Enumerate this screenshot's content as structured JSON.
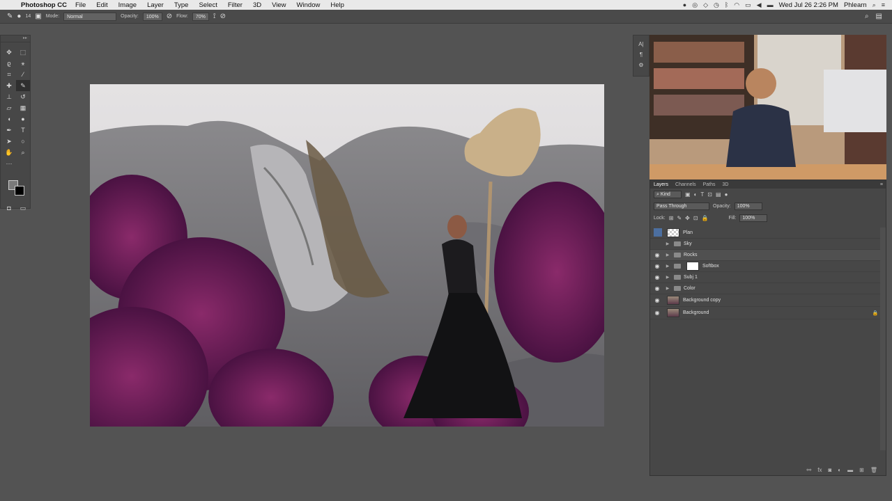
{
  "menubar": {
    "app_name": "Photoshop CC",
    "items": [
      "File",
      "Edit",
      "Image",
      "Layer",
      "Type",
      "Select",
      "Filter",
      "3D",
      "View",
      "Window",
      "Help"
    ],
    "datetime": "Wed Jul 26  2:26 PM",
    "user": "Phlearn"
  },
  "options": {
    "brush_size": "14",
    "mode_label": "Mode:",
    "mode_value": "Normal",
    "opacity_label": "Opacity:",
    "opacity_value": "100%",
    "flow_label": "Flow:",
    "flow_value": "70%"
  },
  "layers_panel": {
    "tabs": [
      "Layers",
      "Channels",
      "Paths",
      "3D"
    ],
    "filter_kind": "Kind",
    "blend_mode": "Pass Through",
    "opacity_label": "Opacity:",
    "opacity_value": "100%",
    "lock_label": "Lock:",
    "fill_label": "Fill:",
    "fill_value": "100%",
    "layers": [
      {
        "name": "Plan",
        "visible": false,
        "type": "layer",
        "thumb": "transparent"
      },
      {
        "name": "Sky",
        "visible": false,
        "type": "group"
      },
      {
        "name": "Rocks",
        "visible": true,
        "type": "group"
      },
      {
        "name": "Softbox",
        "visible": true,
        "type": "group-mask"
      },
      {
        "name": "Subj 1",
        "visible": true,
        "type": "group"
      },
      {
        "name": "Color",
        "visible": true,
        "type": "group"
      },
      {
        "name": "Background copy",
        "visible": true,
        "type": "layer",
        "thumb": "photo"
      },
      {
        "name": "Background",
        "visible": true,
        "type": "layer",
        "thumb": "photo",
        "locked": true
      }
    ]
  },
  "colors": {
    "ui_bg": "#535353",
    "panel": "#474747",
    "foreground": "#7a7a7a",
    "background": "#000000"
  }
}
